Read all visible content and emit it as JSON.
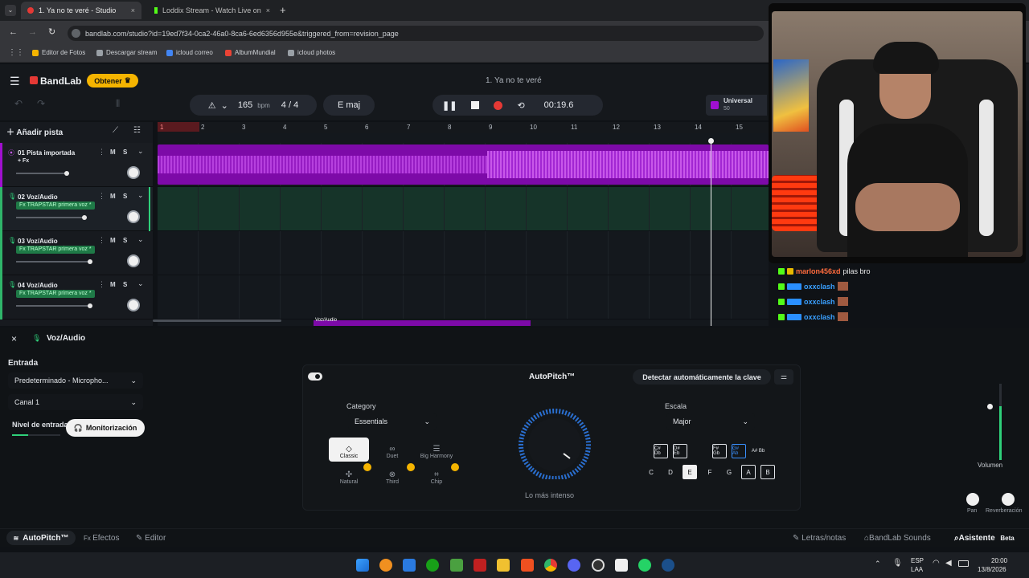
{
  "browser": {
    "tabs": [
      {
        "label": "1. Ya no te veré - Studio",
        "active": true
      },
      {
        "label": "Loddix Stream - Watch Live on",
        "active": false
      }
    ],
    "url": "bandlab.com/studio?id=19ed7f34-0ca2-46a0-8ca6-6ed6356d955e&triggered_from=revision_page",
    "bookmarks": [
      "Editor de Fotos",
      "Descargar stream",
      "icloud correo",
      "AlbumMundial",
      "icloud photos"
    ]
  },
  "app": {
    "brand": "BandLab",
    "get_button": "Obtener",
    "project_title": "1. Ya no te veré",
    "bpm_value": "165",
    "bpm_unit": "bpm",
    "time_signature": "4 / 4",
    "key": "E maj",
    "time": "00:19.6",
    "instrument_name": "Universal",
    "instrument_sub": "50",
    "add_track": "Añadir pista"
  },
  "ruler": [
    "1",
    "2",
    "3",
    "4",
    "5",
    "6",
    "7",
    "8",
    "9",
    "10",
    "11",
    "12",
    "13",
    "14",
    "15"
  ],
  "tracks": [
    {
      "name": "01  Pista importada",
      "fx": "+ Fx",
      "fx_tag": false
    },
    {
      "name": "02  Voz/Audio",
      "fx": "Fx TRAPSTAR primera voz *",
      "fx_tag": true
    },
    {
      "name": "03  Voz/Audio",
      "fx": "Fx TRAPSTAR primera voz *",
      "fx_tag": true
    },
    {
      "name": "04  Voz/Audio",
      "fx": "Fx TRAPSTAR primera voz *",
      "fx_tag": true
    }
  ],
  "track_buttons": {
    "mute": "M",
    "solo": "S"
  },
  "clip_label": "Voz/Audio",
  "chat": [
    {
      "user": "marlon456xd",
      "message": "pilas bro",
      "color": "#ff6b3d"
    },
    {
      "user": "oxxclash",
      "message": "",
      "color": "#3aa0ff"
    },
    {
      "user": "oxxclash",
      "message": "",
      "color": "#3aa0ff"
    },
    {
      "user": "oxxclash",
      "message": "",
      "color": "#3aa0ff"
    }
  ],
  "panel": {
    "track_title": "Voz/Audio",
    "input_label": "Entrada",
    "input_device": "Predeterminado - Micropho...",
    "channel": "Canal 1",
    "input_level": "Nivel de entrada",
    "monitor_button": "Monitorización",
    "plugin_title": "AutoPitch™",
    "detect_key": "Detectar automáticamente la clave",
    "category_label": "Category",
    "category_value": "Essentials",
    "modes": [
      "Classic",
      "Duet",
      "Big Harmony",
      "Natural",
      "Third",
      "Chip"
    ],
    "dial_label": "Lo más intenso",
    "scale_label": "Escala",
    "scale_value": "Major",
    "sharp_keys": [
      "C#\nDb",
      "D#\nEb",
      "F#\nGb",
      "G#\nAb",
      "A#\nBb"
    ],
    "keys": [
      "C",
      "D",
      "E",
      "F",
      "G",
      "A",
      "B"
    ],
    "volume_label": "Volumen",
    "pan_label": "Pan",
    "reverb_label": "Reverberación"
  },
  "bottom_tabs": {
    "autopitch": "AutoPitch™",
    "effects": "Efectos",
    "editor": "Editor",
    "lyrics": "Letras/notas",
    "sounds": "BandLab Sounds",
    "assistant": "Asistente",
    "beta": "Beta"
  },
  "taskbar": {
    "lang": "ESP",
    "lang_sub": "LAA",
    "time": "20:00",
    "date": "13/8/2026"
  },
  "colors": {
    "accent_red": "#e53935",
    "track_purple": "#a010d0",
    "fx_green": "#1f7a47",
    "get_yellow": "#f5b400"
  }
}
